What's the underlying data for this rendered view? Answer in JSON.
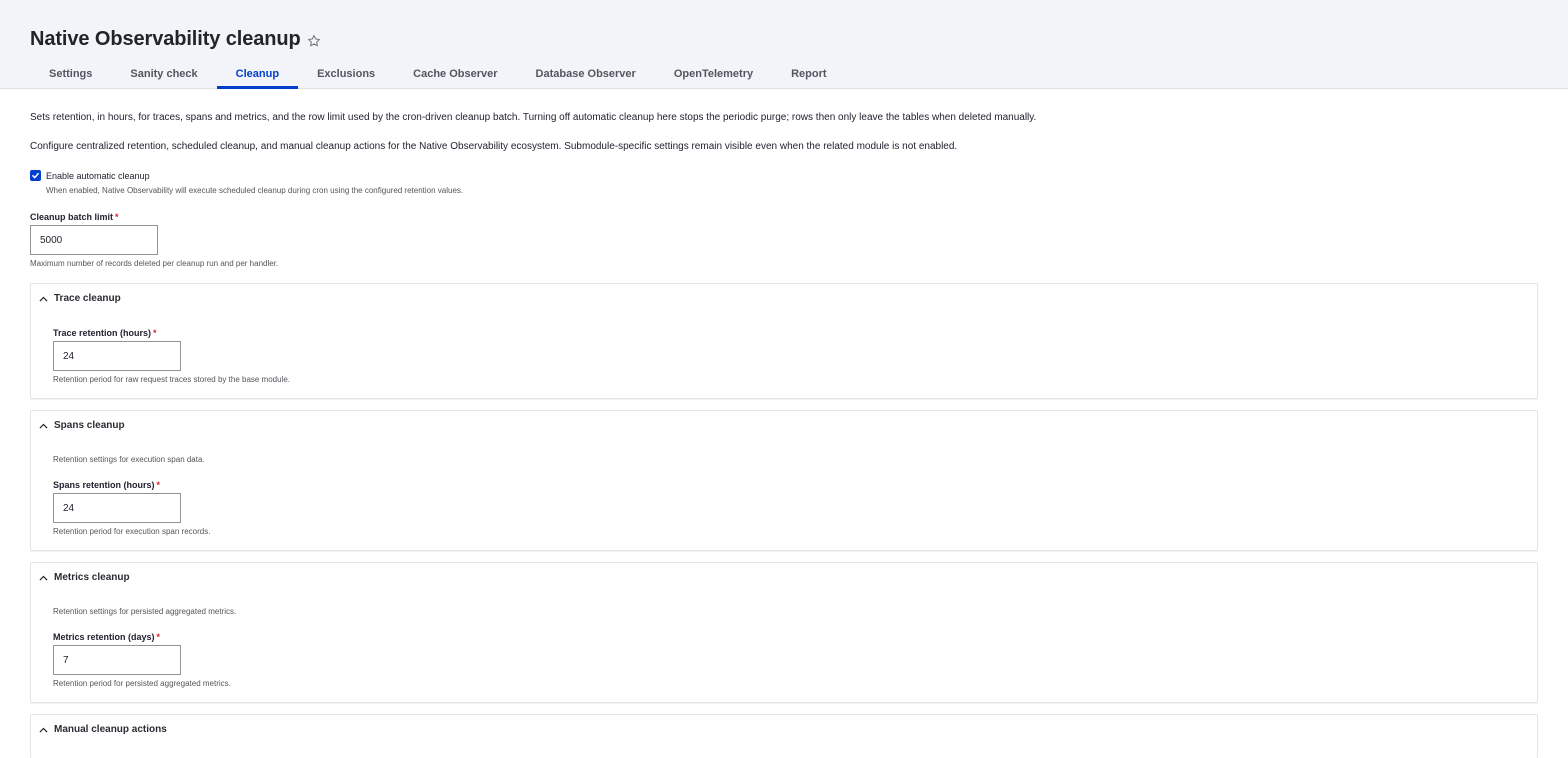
{
  "header": {
    "title": "Native Observability cleanup",
    "tabs": [
      {
        "label": "Settings",
        "active": false
      },
      {
        "label": "Sanity check",
        "active": false
      },
      {
        "label": "Cleanup",
        "active": true
      },
      {
        "label": "Exclusions",
        "active": false
      },
      {
        "label": "Cache Observer",
        "active": false
      },
      {
        "label": "Database Observer",
        "active": false
      },
      {
        "label": "OpenTelemetry",
        "active": false
      },
      {
        "label": "Report",
        "active": false
      }
    ]
  },
  "intro": {
    "line1": "Sets retention, in hours, for traces, spans and metrics, and the row limit used by the cron-driven cleanup batch. Turning off automatic cleanup here stops the periodic purge; rows then only leave the tables when deleted manually.",
    "line2": "Configure centralized retention, scheduled cleanup, and manual cleanup actions for the Native Observability ecosystem. Submodule-specific settings remain visible even when the related module is not enabled."
  },
  "auto_cleanup": {
    "label": "Enable automatic cleanup",
    "checked": true,
    "description": "When enabled, Native Observability will execute scheduled cleanup during cron using the configured retention values."
  },
  "batch_limit": {
    "label": "Cleanup batch limit",
    "required_mark": "*",
    "value": "5000",
    "description": "Maximum number of records deleted per cleanup run and per handler."
  },
  "trace": {
    "legend": "Trace cleanup",
    "field_label": "Trace retention (hours)",
    "required_mark": "*",
    "value": "24",
    "description": "Retention period for raw request traces stored by the base module."
  },
  "spans": {
    "legend": "Spans cleanup",
    "intro": "Retention settings for execution span data.",
    "field_label": "Spans retention (hours)",
    "required_mark": "*",
    "value": "24",
    "description": "Retention period for execution span records."
  },
  "metrics": {
    "legend": "Metrics cleanup",
    "intro": "Retention settings for persisted aggregated metrics.",
    "field_label": "Metrics retention (days)",
    "required_mark": "*",
    "value": "7",
    "description": "Retention period for persisted aggregated metrics."
  },
  "manual": {
    "legend": "Manual cleanup actions"
  },
  "colors": {
    "accent": "#003ecc",
    "required": "#dc2323",
    "header_bg": "#f3f4f9"
  },
  "icons": {
    "favorite": "star-outline-icon",
    "collapse": "chevron-up-icon",
    "checkbox": "checkmark-icon"
  }
}
